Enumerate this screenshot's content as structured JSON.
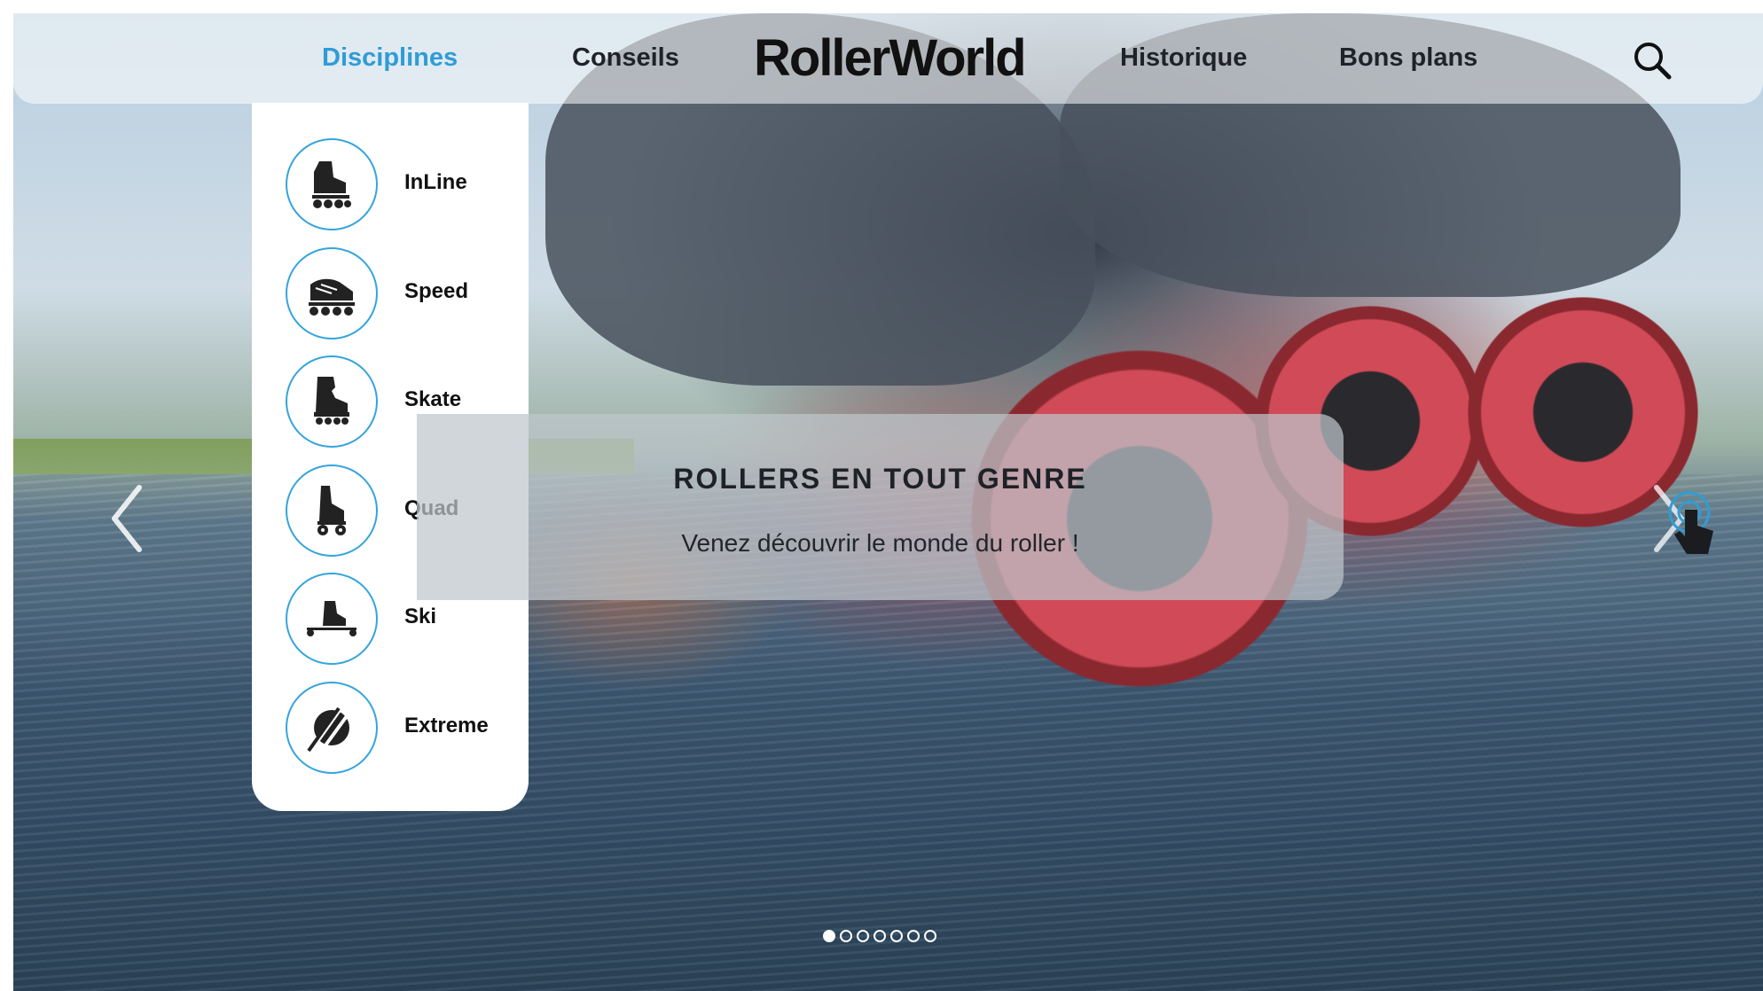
{
  "nav": {
    "links": [
      {
        "label": "Disciplines",
        "active": true
      },
      {
        "label": "Conseils",
        "active": false
      },
      {
        "label": "Historique",
        "active": false
      },
      {
        "label": "Bons plans",
        "active": false
      }
    ],
    "logo": "RollerWorld",
    "search_icon": "search-icon",
    "active_color": "#2f9cd6"
  },
  "disciplines_menu": {
    "items": [
      {
        "label": "InLine",
        "icon": "inline-skate-icon"
      },
      {
        "label": "Speed",
        "icon": "speed-skate-icon"
      },
      {
        "label": "Skate",
        "icon": "aggressive-skate-icon"
      },
      {
        "label": "Quad",
        "icon": "quad-skate-icon"
      },
      {
        "label": "Ski",
        "icon": "roller-ski-icon"
      },
      {
        "label": "Extreme",
        "icon": "extreme-icon"
      }
    ],
    "icon_border_color": "#35a4dc"
  },
  "hero": {
    "title": "ROLLERS EN TOUT GENRE",
    "subtitle": "Venez découvrir le monde du roller !",
    "prev_icon": "chevron-left-icon",
    "next_icon": "chevron-right-icon",
    "slides_total": 7,
    "active_slide": 1
  }
}
